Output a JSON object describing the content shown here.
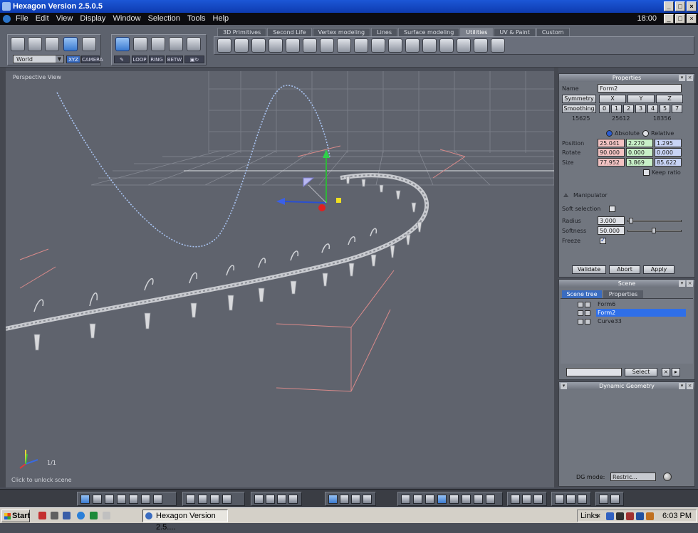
{
  "window": {
    "title": "Hexagon Version 2.5.0.5"
  },
  "menu": {
    "items": [
      "File",
      "Edit",
      "View",
      "Display",
      "Window",
      "Selection",
      "Tools",
      "Help"
    ],
    "clock": "18:00"
  },
  "toolbar": {
    "tabs": [
      "3D Primitives",
      "Second Life",
      "Vertex modeling",
      "Lines",
      "Surface modeling",
      "Utilities",
      "UV & Paint",
      "Custom"
    ],
    "active_tab": "Utilities",
    "coord_system": "World",
    "xyz_label": "XYZ",
    "camera_label": "CAMERA",
    "loop_label": "LOOP",
    "ring_label": "RING",
    "betw_label": "BETW"
  },
  "viewport": {
    "label": "Perspective View",
    "status": "Click to unlock scene",
    "scale": "1/1"
  },
  "properties": {
    "title": "Properties",
    "name_label": "Name",
    "name_value": "Form2",
    "symmetry_label": "Symmetry",
    "smoothing_label": "Smoothing",
    "axes": [
      "X",
      "Y",
      "Z"
    ],
    "smoothing_levels": [
      "0",
      "1",
      "2",
      "3",
      "4",
      "5",
      "7"
    ],
    "counts": [
      "15625",
      "25612",
      "18356"
    ],
    "absolute_label": "Absolute",
    "relative_label": "Relative",
    "position_label": "Position",
    "rotate_label": "Rotate",
    "size_label": "Size",
    "position": [
      "25.041",
      "2.270",
      "1.295"
    ],
    "rotate": [
      "90.000",
      "0.000",
      "0.000"
    ],
    "size": [
      "77.952",
      "3.869",
      "85.622"
    ],
    "keep_ratio_label": "Keep ratio",
    "manipulator_label": "Manipulator",
    "soft_selection_label": "Soft selection",
    "radius_label": "Radius",
    "radius_value": "3.000",
    "softness_label": "Softness",
    "softness_value": "50.000",
    "freeze_label": "Freeze",
    "validate_label": "Validate",
    "abort_label": "Abort",
    "apply_label": "Apply"
  },
  "scene": {
    "title": "Scene",
    "tab_tree": "Scene tree",
    "tab_props": "Properties",
    "items": [
      "Form6",
      "Form2",
      "Curve33"
    ],
    "selected": "Form2",
    "select_label": "Select"
  },
  "dynamic": {
    "title": "Dynamic Geometry",
    "dg_mode_label": "DG mode:",
    "dg_mode_value": "Restric..."
  },
  "taskbar": {
    "start": "Start",
    "task": "Hexagon Version 2.5....",
    "links": "Links",
    "time": "6:03 PM"
  },
  "colors": {
    "accent": "#2f6fe8",
    "titlebar": "#1c57d6",
    "viewport": "#5f636d"
  }
}
